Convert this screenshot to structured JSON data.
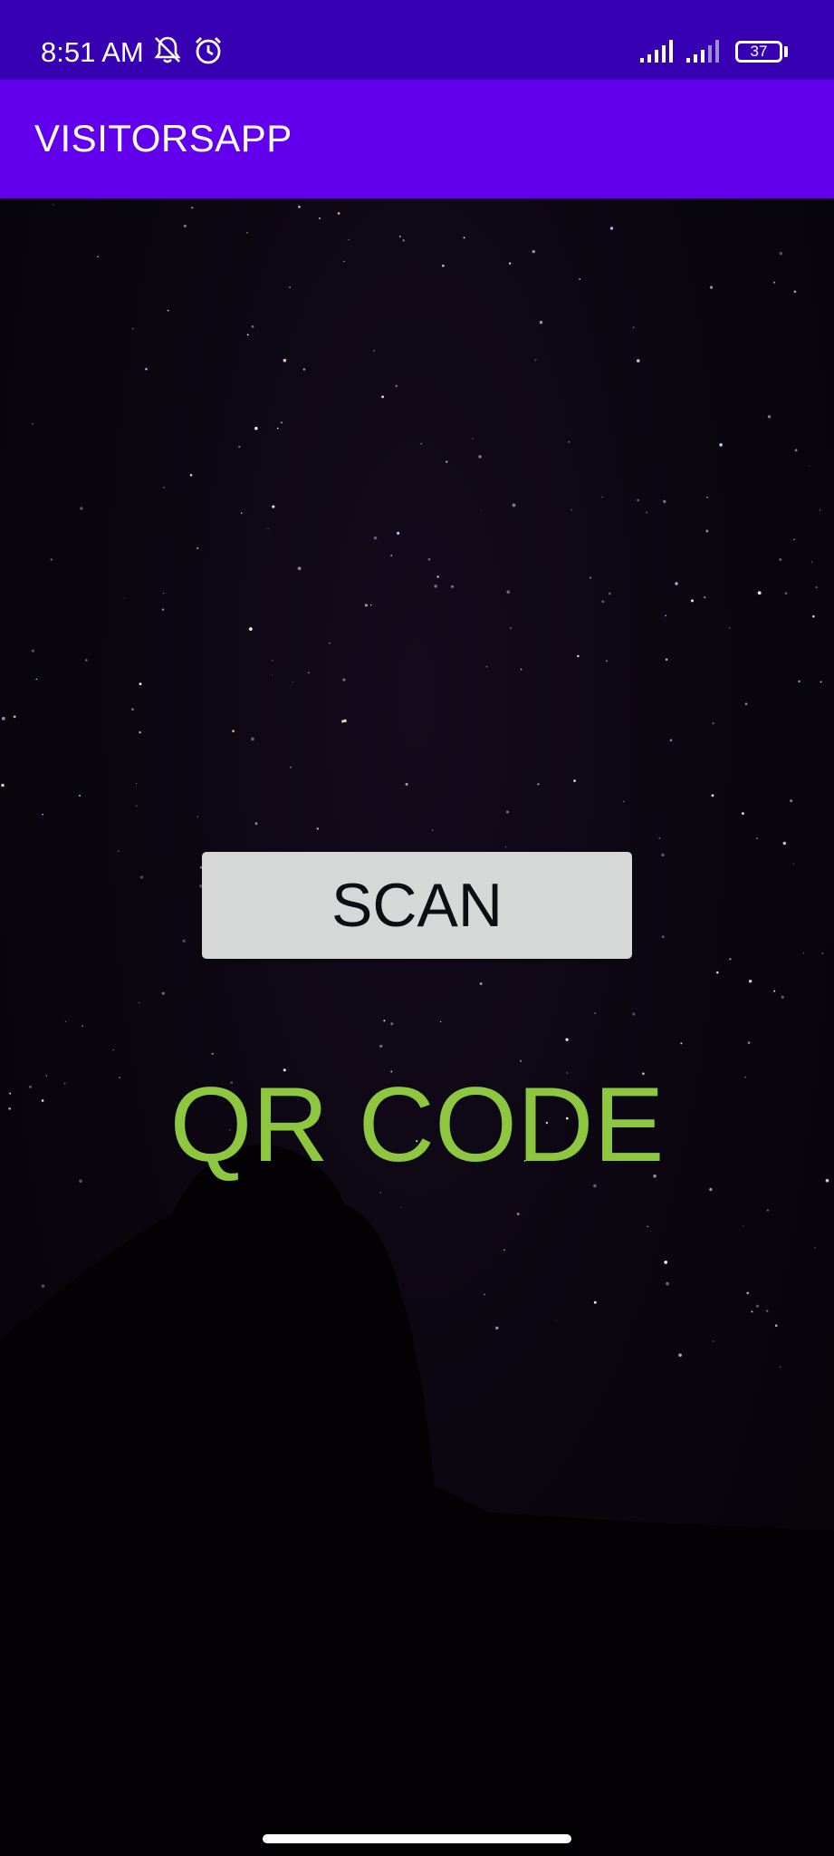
{
  "status_bar": {
    "time": "8:51 AM",
    "battery_level": "37",
    "icons": [
      "notifications-off-icon",
      "alarm-icon",
      "signal-icon",
      "signal-icon-2",
      "battery-icon"
    ]
  },
  "app_bar": {
    "title": "VISITORSAPP"
  },
  "main": {
    "scan_button_label": "SCAN",
    "qr_label": "QR CODE"
  },
  "colors": {
    "status_bar": "#3700b3",
    "app_bar": "#6200ee",
    "qr_label": "#8dc63f",
    "button_bg": "#d6d7d7"
  }
}
